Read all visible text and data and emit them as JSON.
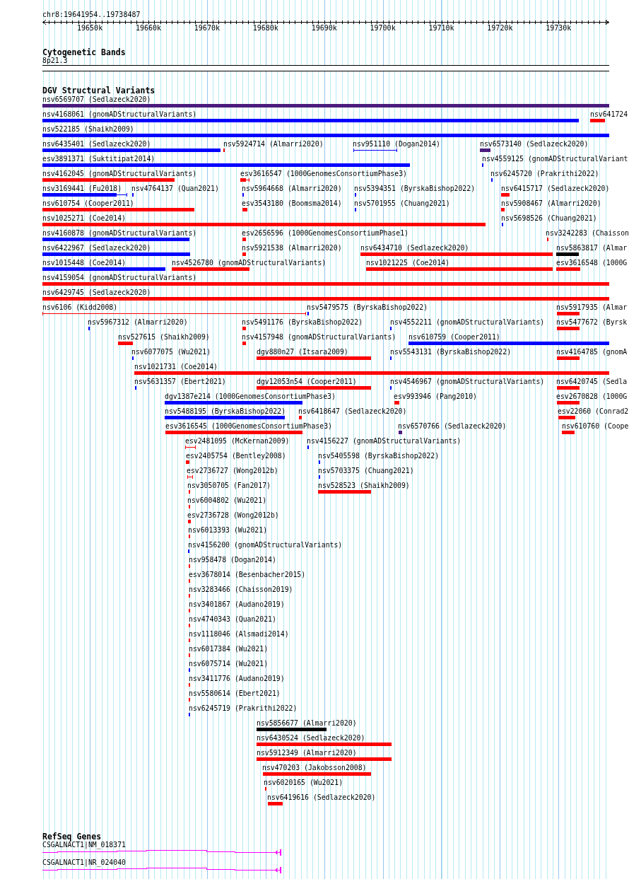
{
  "ruler": {
    "position": "chr8:19641954..19738487",
    "ticks": [
      "19650k",
      "19660k",
      "19670k",
      "19680k",
      "19690k",
      "19700k",
      "19710k",
      "19720k",
      "19730k"
    ]
  },
  "tracks": [
    {
      "kind": "cytoband",
      "title": "Cytogenetic Bands",
      "bands": [
        {
          "label": "8p21.3"
        }
      ]
    },
    {
      "kind": "variants",
      "title": "DGV Structural Variants",
      "rows": [
        [
          {
            "label": "nsv6569707 (Sedlazeck2020)",
            "color": "#4b1b7d"
          }
        ],
        [
          {
            "label": "nsv4168061 (gnomADStructuralVariants)",
            "color": "#0000ff"
          },
          {
            "label": "nsv641724",
            "color": "#ff0000"
          }
        ],
        [
          {
            "label": "nsv522185 (Shaikh2009)",
            "color": "#0000ff"
          }
        ],
        [
          {
            "label": "nsv6435401 (Sedlazeck2020)",
            "color": "#0000ff"
          },
          {
            "label": "nsv5924714 (Almarri2020)",
            "color": "#ff0000"
          },
          {
            "label": "nsv951110 (Dogan2014)",
            "color": "#0000ff"
          },
          {
            "label": "nsv6573140 (Sedlazeck2020)",
            "color": "#4b1b7d"
          }
        ],
        [
          {
            "label": "esv3891371 (Suktitipat2014)",
            "color": "#0000ff"
          },
          {
            "label": "nsv4559125 (gnomADStructuralVariant",
            "color": "#0000ff"
          }
        ],
        [
          {
            "label": "nsv4162045 (gnomADStructuralVariants)",
            "color": "#ff0000"
          },
          {
            "label": "esv3616547 (1000GenomesConsortiumPhase3)",
            "color": "#ff0000"
          },
          {
            "label": "nsv6245720 (Prakrithi2022)",
            "color": "#0000ff"
          }
        ],
        [
          {
            "label": "nsv3169441 (Fu2018)",
            "color": "#0000ff"
          },
          {
            "label": "nsv4764137 (Quan2021)",
            "color": "#0000ff"
          },
          {
            "label": "nsv5964668 (Almarri2020)",
            "color": "#0000ff"
          },
          {
            "label": "nsv5394351 (ByrskaBishop2022)",
            "color": "#0000ff"
          },
          {
            "label": "nsv6415717 (Sedlazeck2020)",
            "color": "#ff0000"
          }
        ],
        [
          {
            "label": "nsv610754 (Cooper2011)",
            "color": "#ff0000"
          },
          {
            "label": "esv3543180 (Boomsma2014)",
            "color": "#ff0000"
          },
          {
            "label": "nsv5701955 (Chuang2021)",
            "color": "#0000ff"
          },
          {
            "label": "nsv5908467 (Almarri2020)",
            "color": "#ff0000"
          }
        ],
        [
          {
            "label": "nsv1025271 (Coe2014)",
            "color": "#ff0000"
          },
          {
            "label": "nsv5698526 (Chuang2021)",
            "color": "#0000ff"
          }
        ],
        [
          {
            "label": "nsv4160878 (gnomADStructuralVariants)",
            "color": "#0000ff"
          },
          {
            "label": "esv2656596 (1000GenomesConsortiumPhase1)",
            "color": "#ff0000"
          },
          {
            "label": "nsv3242283 (Chaisson",
            "color": "#ff0000"
          }
        ],
        [
          {
            "label": "nsv6422967 (Sedlazeck2020)",
            "color": "#0000ff"
          },
          {
            "label": "nsv5921538 (Almarri2020)",
            "color": "#ff0000"
          },
          {
            "label": "nsv6434710 (Sedlazeck2020)",
            "color": "#ff0000"
          },
          {
            "label": "nsv5863817 (Almar",
            "color": "#000000"
          }
        ],
        [
          {
            "label": "nsv1015448 (Coe2014)",
            "color": "#0000ff"
          },
          {
            "label": "nsv4526780 (gnomADStructuralVariants)",
            "color": "#ff0000"
          },
          {
            "label": "nsv1021225 (Coe2014)",
            "color": "#ff0000"
          },
          {
            "label": "esv3616548 (1000G",
            "color": "#ff0000"
          }
        ],
        [
          {
            "label": "nsv4159054 (gnomADStructuralVariants)",
            "color": "#ff0000"
          }
        ],
        [
          {
            "label": "nsv6429745 (Sedlazeck2020)",
            "color": "#ff0000"
          }
        ],
        [
          {
            "label": "nsv6106 (Kidd2008)",
            "color": "#ff0000"
          },
          {
            "label": "nsv5479575 (ByrskaBishop2022)",
            "color": "#0000ff"
          },
          {
            "label": "nsv5917935 (Almar",
            "color": "#ff0000"
          }
        ],
        [
          {
            "label": "nsv5967312 (Almarri2020)",
            "color": "#0000ff"
          },
          {
            "label": "nsv5491176 (ByrskaBishop2022)",
            "color": "#ff0000"
          },
          {
            "label": "nsv4552211 (gnomADStructuralVariants)",
            "color": "#0000ff"
          },
          {
            "label": "nsv5477672 (Byrsk",
            "color": "#ff0000"
          }
        ],
        [
          {
            "label": "nsv527615 (Shaikh2009)",
            "color": "#ff0000"
          },
          {
            "label": "nsv4157948 (gnomADStructuralVariants)",
            "color": "#ff0000"
          },
          {
            "label": "nsv610759 (Cooper2011)",
            "color": "#0000ff"
          }
        ],
        [
          {
            "label": "nsv6077075 (Wu2021)",
            "color": "#0000ff"
          },
          {
            "label": "dgv880n27 (Itsara2009)",
            "color": "#ff0000"
          },
          {
            "label": "nsv5543131 (ByrskaBishop2022)",
            "color": "#0000ff"
          },
          {
            "label": "nsv4164785 (gnomA",
            "color": "#ff0000"
          }
        ],
        [
          {
            "label": "nsv1021731 (Coe2014)",
            "color": "#ff0000"
          }
        ],
        [
          {
            "label": "nsv5631357 (Ebert2021)",
            "color": "#0000ff"
          },
          {
            "label": "dgv12053n54 (Cooper2011)",
            "color": "#ff0000"
          },
          {
            "label": "nsv4546967 (gnomADStructuralVariants)",
            "color": "#0000ff"
          },
          {
            "label": "nsv6420745 (Sedla",
            "color": "#ff0000"
          }
        ],
        [
          {
            "label": "dgv1387e214 (1000GenomesConsortiumPhase3)",
            "color": "#0000ff"
          },
          {
            "label": "esv993946 (Pang2010)",
            "color": "#ff0000"
          },
          {
            "label": "esv2670828 (1000G",
            "color": "#ff0000"
          }
        ],
        [
          {
            "label": "nsv5488195 (ByrskaBishop2022)",
            "color": "#0000ff"
          },
          {
            "label": "nsv6418647 (Sedlazeck2020)",
            "color": "#ff0000"
          },
          {
            "label": "esv22060 (Conrad2",
            "color": "#ff0000"
          }
        ],
        [
          {
            "label": "esv3616545 (1000GenomesConsortiumPhase3)",
            "color": "#ff0000"
          },
          {
            "label": "nsv6570766 (Sedlazeck2020)",
            "color": "#4b1b7d"
          },
          {
            "label": "nsv610760 (Coope",
            "color": "#ff0000"
          }
        ],
        [
          {
            "label": "esv2481095 (McKernan2009)",
            "color": "#ff0000"
          },
          {
            "label": "nsv4156227 (gnomADStructuralVariants)",
            "color": "#0000ff"
          }
        ],
        [
          {
            "label": "esv2405754 (Bentley2008)",
            "color": "#ff0000"
          },
          {
            "label": "nsv5405598 (ByrskaBishop2022)",
            "color": "#0000ff"
          }
        ],
        [
          {
            "label": "esv2736727 (Wong2012b)",
            "color": "#ff0000"
          },
          {
            "label": "nsv5703375 (Chuang2021)",
            "color": "#0000ff"
          }
        ],
        [
          {
            "label": "nsv3050705 (Fan2017)",
            "color": "#ff0000"
          },
          {
            "label": "nsv528523 (Shaikh2009)",
            "color": "#ff0000"
          }
        ],
        [
          {
            "label": "nsv6004802 (Wu2021)",
            "color": "#ff0000"
          }
        ],
        [
          {
            "label": "esv2736728 (Wong2012b)",
            "color": "#ff0000"
          }
        ],
        [
          {
            "label": "nsv6013393 (Wu2021)",
            "color": "#ff0000"
          }
        ],
        [
          {
            "label": "nsv4156200 (gnomADStructuralVariants)",
            "color": "#0000ff"
          }
        ],
        [
          {
            "label": "nsv958478 (Dogan2014)",
            "color": "#ff0000"
          }
        ],
        [
          {
            "label": "esv3678014 (Besenbacher2015)",
            "color": "#ff0000"
          }
        ],
        [
          {
            "label": "nsv3283466 (Chaisson2019)",
            "color": "#ff0000"
          }
        ],
        [
          {
            "label": "nsv3401867 (Audano2019)",
            "color": "#ff0000"
          }
        ],
        [
          {
            "label": "nsv4740343 (Quan2021)",
            "color": "#ff0000"
          }
        ],
        [
          {
            "label": "nsv1118046 (Alsmadi2014)",
            "color": "#ff0000"
          }
        ],
        [
          {
            "label": "nsv6017384 (Wu2021)",
            "color": "#ff0000"
          }
        ],
        [
          {
            "label": "nsv6075714 (Wu2021)",
            "color": "#0000ff"
          }
        ],
        [
          {
            "label": "nsv3411776 (Audano2019)",
            "color": "#ff0000"
          }
        ],
        [
          {
            "label": "nsv5580614 (Ebert2021)",
            "color": "#ff0000"
          }
        ],
        [
          {
            "label": "nsv6245719 (Prakrithi2022)",
            "color": "#0000ff"
          }
        ],
        [
          {
            "label": "nsv5856677 (Almarri2020)",
            "color": "#000000"
          }
        ],
        [
          {
            "label": "nsv6430524 (Sedlazeck2020)",
            "color": "#ff0000"
          }
        ],
        [
          {
            "label": "nsv5912349 (Almarri2020)",
            "color": "#ff0000"
          }
        ],
        [
          {
            "label": "nsv470203 (Jakobsson2008)",
            "color": "#ff0000"
          }
        ],
        [
          {
            "label": "nsv6020165 (Wu2021)",
            "color": "#ff0000"
          }
        ],
        [
          {
            "label": "nsv6419616 (Sedlazeck2020)",
            "color": "#ff0000"
          }
        ]
      ]
    },
    {
      "kind": "genes",
      "title": "RefSeq Genes",
      "genes": [
        {
          "label": "CSGALNACT1|NM_018371"
        },
        {
          "label": "CSGALNACT1|NR_024040"
        }
      ]
    }
  ]
}
